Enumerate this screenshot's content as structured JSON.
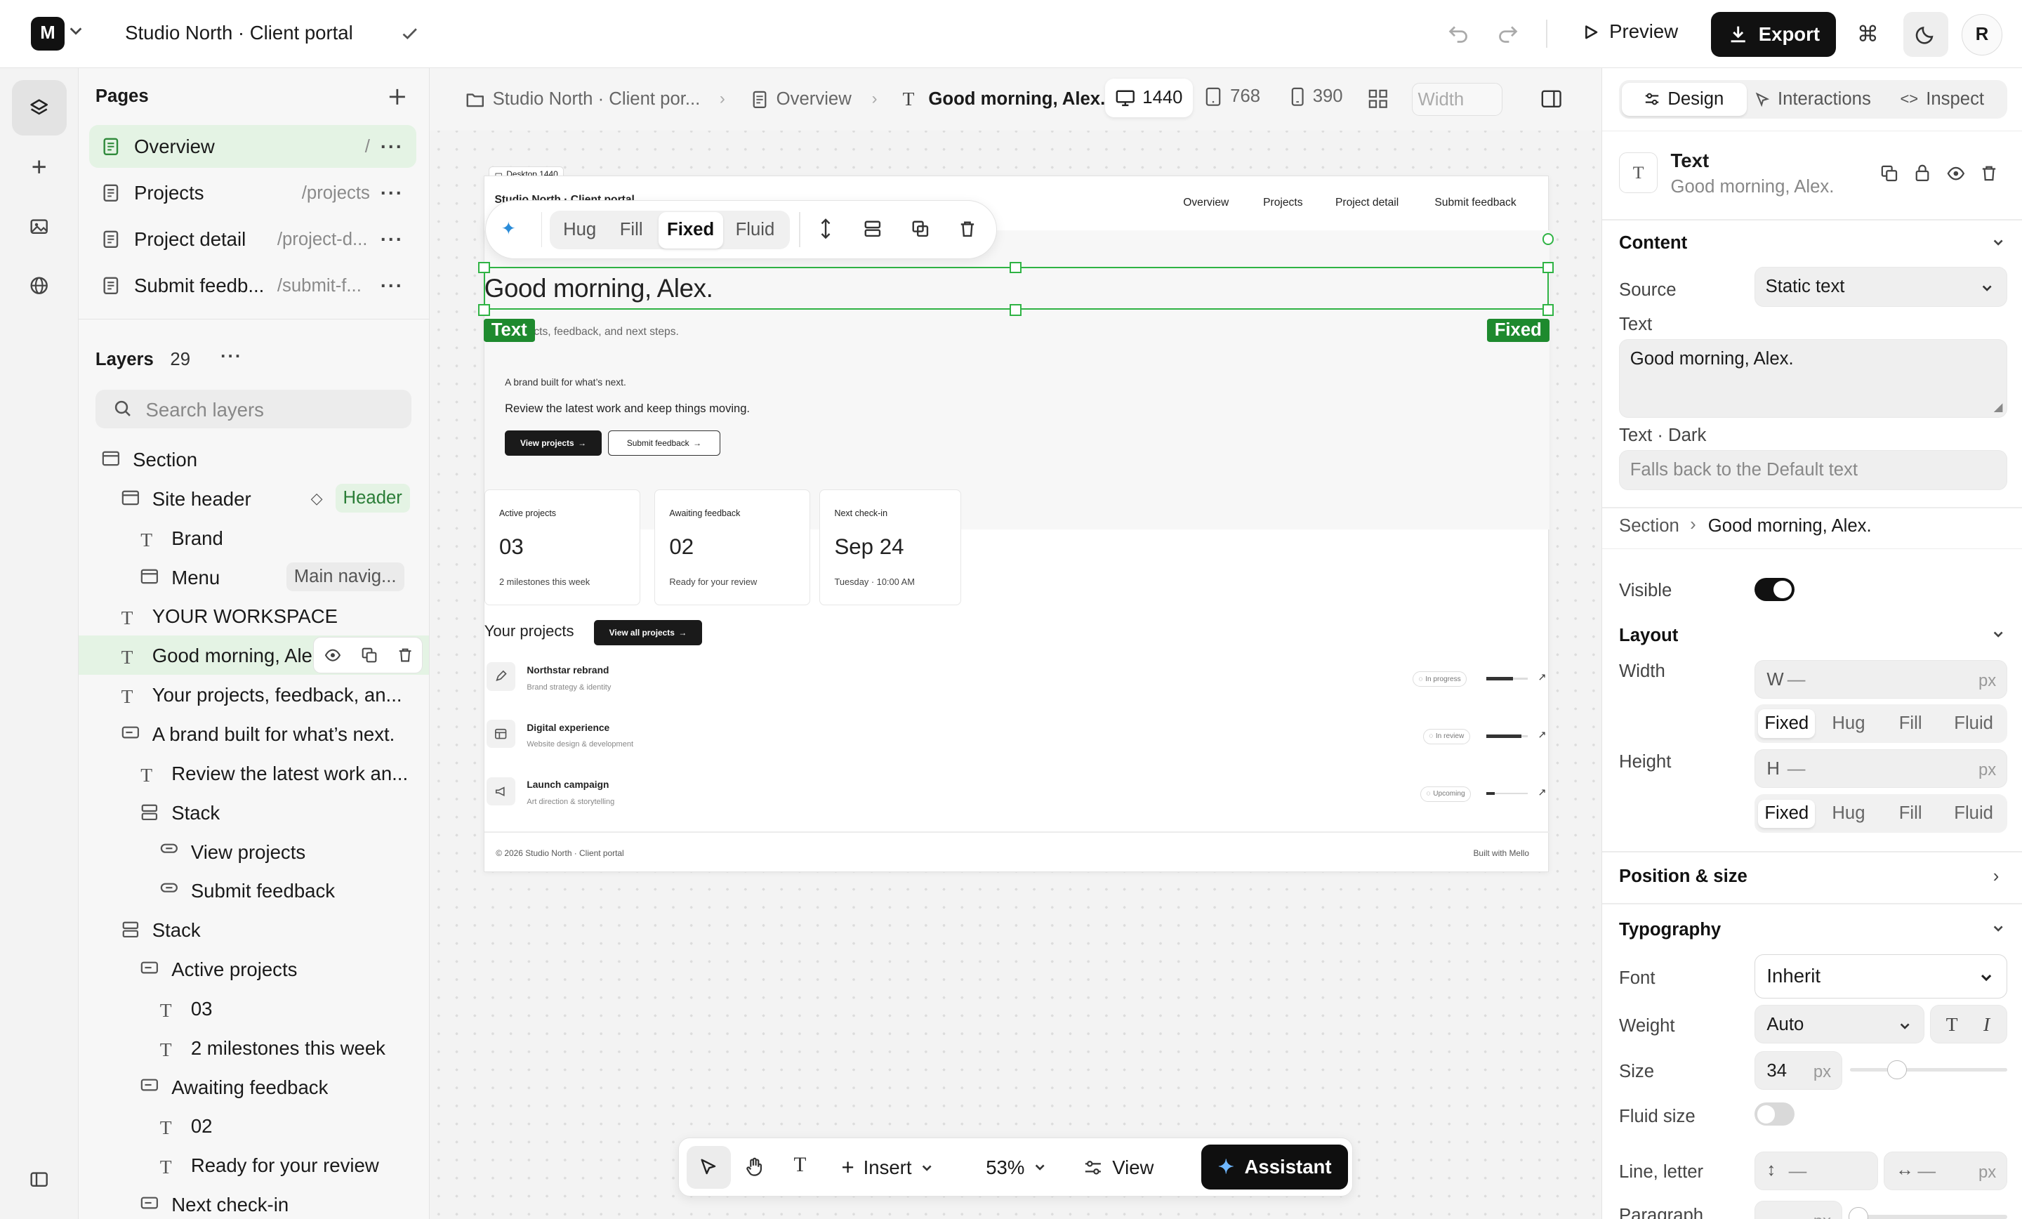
{
  "topbar": {
    "logo": "M",
    "project_title": "Studio North · Client portal",
    "preview_label": "Preview",
    "export_label": "Export",
    "avatar_initial": "R"
  },
  "pages": {
    "title": "Pages",
    "items": [
      {
        "name": "Overview",
        "path": "/"
      },
      {
        "name": "Projects",
        "path": "/projects"
      },
      {
        "name": "Project detail",
        "path": "/project-d..."
      },
      {
        "name": "Submit feedb...",
        "path": "/submit-f..."
      }
    ]
  },
  "layers": {
    "title": "Layers",
    "count": "29",
    "search_placeholder": "Search layers",
    "items": [
      {
        "name": "Section",
        "icon": "section-icon"
      },
      {
        "name": "Site header",
        "icon": "section-icon",
        "badge": "Header"
      },
      {
        "name": "Brand",
        "icon": "text-icon"
      },
      {
        "name": "Menu",
        "icon": "section-icon",
        "badge": "Main navig..."
      },
      {
        "name": "YOUR WORKSPACE",
        "icon": "text-icon"
      },
      {
        "name": "Good morning, Ale",
        "icon": "text-icon"
      },
      {
        "name": "Your projects, feedback, an...",
        "icon": "text-icon"
      },
      {
        "name": "A brand built for what’s next.",
        "icon": "container-icon"
      },
      {
        "name": "Review the latest work an...",
        "icon": "text-icon"
      },
      {
        "name": "Stack",
        "icon": "stack-icon"
      },
      {
        "name": "View projects",
        "icon": "link-icon"
      },
      {
        "name": "Submit feedback",
        "icon": "link-icon"
      },
      {
        "name": "Stack",
        "icon": "stack-icon"
      },
      {
        "name": "Active projects",
        "icon": "container-icon"
      },
      {
        "name": "03",
        "icon": "text-icon"
      },
      {
        "name": "2 milestones this week",
        "icon": "text-icon"
      },
      {
        "name": "Awaiting feedback",
        "icon": "container-icon"
      },
      {
        "name": "02",
        "icon": "text-icon"
      },
      {
        "name": "Ready for your review",
        "icon": "text-icon"
      },
      {
        "name": "Next check-in",
        "icon": "container-icon"
      }
    ]
  },
  "breadcrumb": {
    "items": [
      "Studio North · Client por...",
      "Overview",
      "Good morning, Alex."
    ],
    "bp_desktop": "1440",
    "bp_tablet": "768",
    "bp_mobile": "390",
    "width_placeholder": "Width"
  },
  "frame": {
    "label": "Desktop 1440",
    "brand": "Studio North · Client portal",
    "nav": [
      "Overview",
      "Projects",
      "Project detail",
      "Submit feedback"
    ],
    "heading": "Good morning, Alex.",
    "subtext": "Your projects, feedback, and next steps.",
    "hero_kicker": "A brand built for what’s next.",
    "hero_body": "Review the latest work and keep things moving.",
    "btn_primary": "View projects",
    "btn_secondary": "Submit feedback",
    "cards": [
      {
        "label": "Active projects",
        "value": "03",
        "note": "2 milestones this week"
      },
      {
        "label": "Awaiting feedback",
        "value": "02",
        "note": "Ready for your review"
      },
      {
        "label": "Next check-in",
        "value": "Sep 24",
        "note": "Tuesday · 10:00 AM"
      }
    ],
    "projects_title": "Your projects",
    "projects_btn": "View all projects",
    "projects": [
      {
        "name": "Northstar rebrand",
        "sub": "Brand strategy & identity",
        "status": "In progress",
        "progress": 0.65
      },
      {
        "name": "Digital experience",
        "sub": "Website design & development",
        "status": "In review",
        "progress": 0.85
      },
      {
        "name": "Launch campaign",
        "sub": "Art direction & storytelling",
        "status": "Upcoming",
        "progress": 0.2
      }
    ],
    "footer_left": "© 2026 Studio North · Client portal",
    "footer_right": "Built with Mello"
  },
  "selection": {
    "tag_left": "Text",
    "tag_right": "Fixed"
  },
  "float_toolbar": {
    "options": [
      "Hug",
      "Fill",
      "Fixed",
      "Fluid"
    ],
    "active": "Fixed"
  },
  "bottom_toolbar": {
    "insert_label": "Insert",
    "zoom_label": "53%",
    "view_label": "View",
    "assistant_label": "Assistant"
  },
  "inspector": {
    "tabs": [
      "Design",
      "Interactions",
      "Inspect"
    ],
    "element_type": "Text",
    "element_name": "Good morning, Alex.",
    "content_title": "Content",
    "source_label": "Source",
    "source_value": "Static text",
    "text_label": "Text",
    "text_value": "Good morning, Alex.",
    "text_dark_label": "Text · Dark",
    "text_dark_placeholder": "Falls back to the Default text",
    "path_parent": "Section",
    "path_current": "Good morning, Alex.",
    "visible_label": "Visible",
    "layout_title": "Layout",
    "width_label": "Width",
    "width_prefix": "W",
    "width_value": "—",
    "height_label": "Height",
    "height_prefix": "H",
    "height_value": "—",
    "unit": "px",
    "sizing_options": [
      "Fixed",
      "Hug",
      "Fill",
      "Fluid"
    ],
    "position_title": "Position & size",
    "typography_title": "Typography",
    "font_label": "Font",
    "font_value": "Inherit",
    "weight_label": "Weight",
    "weight_value": "Auto",
    "size_label": "Size",
    "size_value": "34",
    "fluid_size_label": "Fluid size",
    "line_letter_label": "Line, letter",
    "line_value": "—",
    "letter_value": "—",
    "paragraph_label": "Paragraph",
    "paragraph_value": "—"
  },
  "colors": {
    "accent_green": "#2fb344",
    "selected_bg": "#e4f3e4",
    "dark": "#111111"
  }
}
